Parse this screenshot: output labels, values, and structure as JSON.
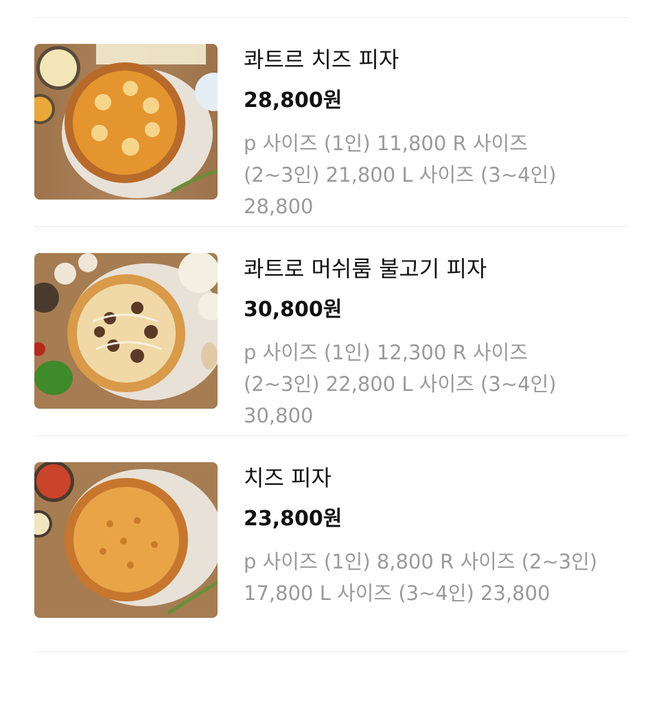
{
  "menu": {
    "items": [
      {
        "name": "콰트르 치즈 피자",
        "price": "28,800원",
        "desc_lines": [
          "p 사이즈 (1인) 11,800 R 사이즈",
          "(2~3인) 21,800 L 사이즈 (3~4인)",
          "28,800"
        ]
      },
      {
        "name": "콰트로 머쉬룸 불고기 피자",
        "price": "30,800원",
        "desc_lines": [
          "p 사이즈 (1인) 12,300 R 사이즈",
          "(2~3인) 22,800 L 사이즈 (3~4인)",
          "30,800"
        ]
      },
      {
        "name": "치즈 피자",
        "price": "23,800원",
        "desc_lines": [
          "p 사이즈 (1인) 8,800 R 사이즈 (2~3인)",
          "17,800 L 사이즈 (3~4인) 23,800"
        ]
      }
    ]
  },
  "colors": {
    "text_primary": "#111111",
    "text_secondary": "#9a9a9a",
    "divider": "#e9e9e9",
    "wood_table": "#a37a50"
  }
}
